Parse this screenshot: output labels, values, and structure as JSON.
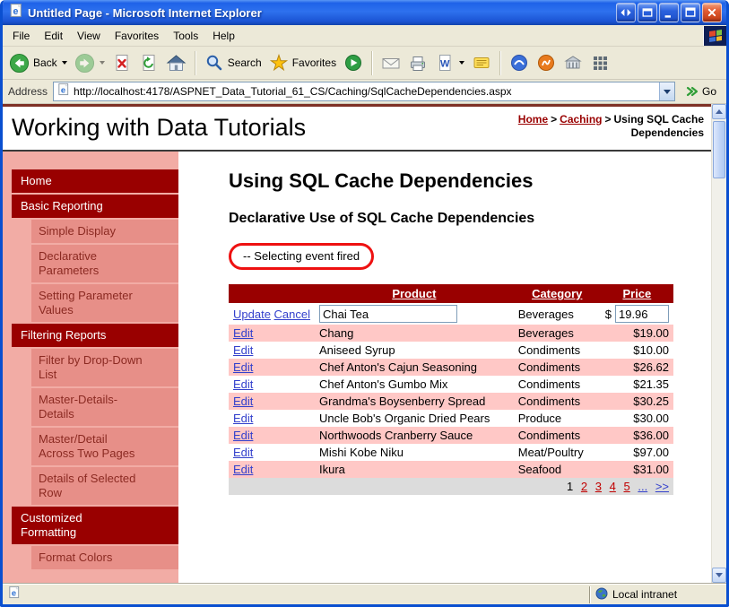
{
  "window": {
    "title": "Untitled Page - Microsoft Internet Explorer"
  },
  "menu": {
    "items": [
      {
        "label": "File"
      },
      {
        "label": "Edit"
      },
      {
        "label": "View"
      },
      {
        "label": "Favorites"
      },
      {
        "label": "Tools"
      },
      {
        "label": "Help"
      }
    ]
  },
  "toolbar": {
    "back_label": "Back",
    "search_label": "Search",
    "favorites_label": "Favorites"
  },
  "address": {
    "label": "Address",
    "url": "http://localhost:4178/ASPNET_Data_Tutorial_61_CS/Caching/SqlCacheDependencies.aspx",
    "go_label": "Go"
  },
  "site_header": {
    "title": "Working with Data Tutorials",
    "breadcrumb": {
      "home": "Home",
      "caching": "Caching",
      "current": "Using SQL Cache Dependencies",
      "separator": ">"
    }
  },
  "sidebar": {
    "items": [
      {
        "label": "Home"
      },
      {
        "label": "Basic Reporting"
      },
      {
        "label": "Simple Display"
      },
      {
        "label": "Declarative Parameters"
      },
      {
        "label": "Setting Parameter Values"
      },
      {
        "label": "Filtering Reports"
      },
      {
        "label": "Filter by Drop-Down List"
      },
      {
        "label": "Master-Details-Details"
      },
      {
        "label": "Master/Detail Across Two Pages"
      },
      {
        "label": "Details of Selected Row"
      },
      {
        "label": "Customized Formatting"
      },
      {
        "label": "Format Colors"
      }
    ]
  },
  "main": {
    "h1": "Using SQL Cache Dependencies",
    "h2": "Declarative Use of SQL Cache Dependencies",
    "callout": "-- Selecting event fired",
    "table": {
      "headers": [
        "",
        "Product",
        "Category",
        "Price"
      ],
      "edit_row": {
        "update_label": "Update",
        "cancel_label": "Cancel",
        "product_value": "Chai Tea",
        "category": "Beverages",
        "currency": "$",
        "price_value": "19.96"
      },
      "rows": [
        {
          "action": "Edit",
          "product": "Chang",
          "category": "Beverages",
          "price": "$19.00"
        },
        {
          "action": "Edit",
          "product": "Aniseed Syrup",
          "category": "Condiments",
          "price": "$10.00"
        },
        {
          "action": "Edit",
          "product": "Chef Anton's Cajun Seasoning",
          "category": "Condiments",
          "price": "$26.62"
        },
        {
          "action": "Edit",
          "product": "Chef Anton's Gumbo Mix",
          "category": "Condiments",
          "price": "$21.35"
        },
        {
          "action": "Edit",
          "product": "Grandma's Boysenberry Spread",
          "category": "Condiments",
          "price": "$30.25"
        },
        {
          "action": "Edit",
          "product": "Uncle Bob's Organic Dried Pears",
          "category": "Produce",
          "price": "$30.00"
        },
        {
          "action": "Edit",
          "product": "Northwoods Cranberry Sauce",
          "category": "Condiments",
          "price": "$36.00"
        },
        {
          "action": "Edit",
          "product": "Mishi Kobe Niku",
          "category": "Meat/Poultry",
          "price": "$97.00"
        },
        {
          "action": "Edit",
          "product": "Ikura",
          "category": "Seafood",
          "price": "$31.00"
        }
      ],
      "pager": {
        "current": "1",
        "links": [
          "2",
          "3",
          "4",
          "5"
        ],
        "ellipsis": "...",
        "next": ">>"
      }
    }
  },
  "status": {
    "zone": "Local intranet"
  },
  "colors": {
    "accent_maroon": "#990000",
    "row_pink": "#FFC8C6",
    "sidebar_strip": "#F2ACA5",
    "sidebar_child": "#E78F88",
    "sidebar_child_text": "#8B2A22",
    "link_blue": "#3340CC",
    "pager_link": "#C00000",
    "callout_red": "#EE1111",
    "frame_blue": "#0A4FD0",
    "chrome_tan": "#ECE9D8",
    "pager_gray": "#DCDCDC",
    "rule_maroon": "#7E3025"
  }
}
